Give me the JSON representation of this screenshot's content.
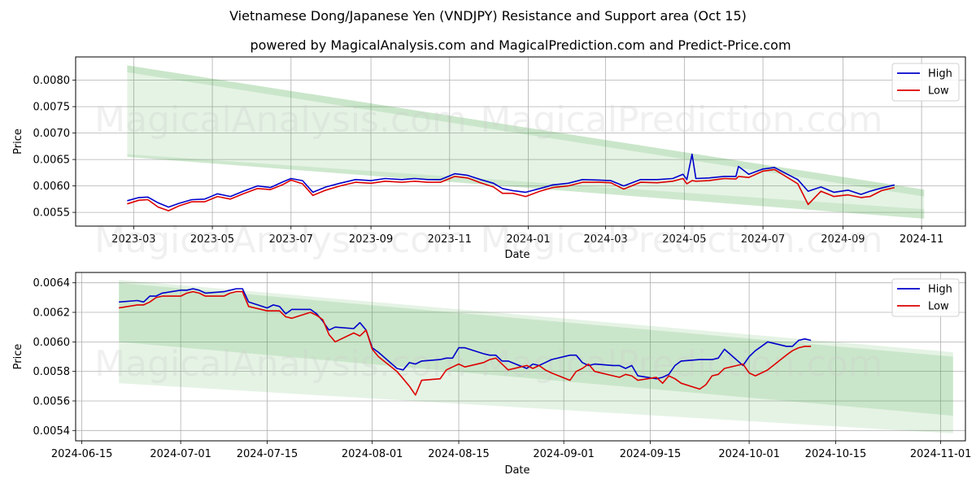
{
  "title": "Vietnamese Dong/Japanese Yen (VNDJPY) Resistance and Support area (Oct 15)",
  "subtitle": "powered by MagicalAnalysis.com and MagicalPrediction.com and Predict-Price.com",
  "watermarks": [
    "MagicalAnalysis.com",
    "MagicalPrediction.com"
  ],
  "colors": {
    "high": "#0000cc",
    "low": "#dd0000",
    "band": "#2ca02c"
  },
  "chart_data": [
    {
      "type": "line",
      "name": "full-history",
      "xlabel": "Date",
      "ylabel": "Price",
      "xlim": [
        "2023-01-15",
        "2024-12-05"
      ],
      "ylim": [
        0.00524,
        0.00844
      ],
      "grid": true,
      "legend": "top-right",
      "legend_entries": [
        "High",
        "Low"
      ],
      "xticks": [
        "2023-03",
        "2023-05",
        "2023-07",
        "2023-09",
        "2023-11",
        "2024-01",
        "2024-03",
        "2024-05",
        "2024-07",
        "2024-09",
        "2024-11"
      ],
      "xtick_dates": [
        "2023-03-01",
        "2023-05-01",
        "2023-07-01",
        "2023-09-01",
        "2023-11-01",
        "2024-01-01",
        "2024-03-01",
        "2024-05-01",
        "2024-07-01",
        "2024-09-01",
        "2024-11-01"
      ],
      "yticks": [
        "0.0055",
        "0.0060",
        "0.0065",
        "0.0070",
        "0.0075",
        "0.0080"
      ],
      "ytick_values": [
        0.0055,
        0.006,
        0.0065,
        0.007,
        0.0075,
        0.008
      ],
      "bands": {
        "start": "2023-02-24",
        "end": "2024-11-03",
        "resistance_outer": [
          0.00828,
          0.00593
        ],
        "resistance_inner": [
          0.00815,
          0.0058
        ],
        "support_inner": [
          0.0066,
          0.00556
        ],
        "support_outer": [
          0.00655,
          0.00538
        ]
      },
      "x": [
        "2023-02-24",
        "2023-03-05",
        "2023-03-12",
        "2023-03-20",
        "2023-03-28",
        "2023-04-05",
        "2023-04-15",
        "2023-04-25",
        "2023-05-05",
        "2023-05-15",
        "2023-05-25",
        "2023-06-05",
        "2023-06-15",
        "2023-06-25",
        "2023-07-01",
        "2023-07-10",
        "2023-07-18",
        "2023-07-28",
        "2023-08-08",
        "2023-08-20",
        "2023-09-01",
        "2023-09-12",
        "2023-09-25",
        "2023-10-05",
        "2023-10-15",
        "2023-10-25",
        "2023-11-05",
        "2023-11-15",
        "2023-11-25",
        "2023-12-05",
        "2023-12-12",
        "2023-12-20",
        "2023-12-30",
        "2024-01-10",
        "2024-01-20",
        "2024-02-01",
        "2024-02-12",
        "2024-02-25",
        "2024-03-05",
        "2024-03-15",
        "2024-03-28",
        "2024-04-10",
        "2024-04-22",
        "2024-04-30",
        "2024-05-03",
        "2024-05-07",
        "2024-05-10",
        "2024-05-20",
        "2024-06-01",
        "2024-06-10",
        "2024-06-12",
        "2024-06-20",
        "2024-07-01",
        "2024-07-10",
        "2024-07-20",
        "2024-07-28",
        "2024-08-05",
        "2024-08-15",
        "2024-08-25",
        "2024-09-05",
        "2024-09-15",
        "2024-09-22",
        "2024-10-01",
        "2024-10-11"
      ],
      "series": [
        {
          "name": "High",
          "values": [
            0.00572,
            0.00578,
            0.00579,
            0.00568,
            0.0056,
            0.00567,
            0.00574,
            0.00575,
            0.00585,
            0.0058,
            0.0059,
            0.006,
            0.00597,
            0.00608,
            0.00614,
            0.0061,
            0.00588,
            0.00598,
            0.00605,
            0.00612,
            0.0061,
            0.00614,
            0.00612,
            0.00614,
            0.00612,
            0.00612,
            0.00623,
            0.0062,
            0.00612,
            0.00605,
            0.00595,
            0.00591,
            0.00588,
            0.00595,
            0.00602,
            0.00605,
            0.00612,
            0.00611,
            0.0061,
            0.006,
            0.00612,
            0.00612,
            0.00614,
            0.00622,
            0.00612,
            0.0066,
            0.00614,
            0.00615,
            0.00618,
            0.00618,
            0.00637,
            0.00622,
            0.00632,
            0.00635,
            0.00622,
            0.00612,
            0.0059,
            0.00598,
            0.00588,
            0.00592,
            0.00584,
            0.0059,
            0.00596,
            0.00602
          ]
        },
        {
          "name": "Low",
          "values": [
            0.00566,
            0.00573,
            0.00574,
            0.0056,
            0.00553,
            0.00562,
            0.0057,
            0.0057,
            0.0058,
            0.00575,
            0.00585,
            0.00595,
            0.00593,
            0.00603,
            0.00611,
            0.00604,
            0.00582,
            0.00592,
            0.006,
            0.00607,
            0.00605,
            0.00609,
            0.00607,
            0.00609,
            0.00607,
            0.00607,
            0.00618,
            0.00615,
            0.00606,
            0.00598,
            0.00586,
            0.00586,
            0.0058,
            0.0059,
            0.00597,
            0.006,
            0.00607,
            0.00607,
            0.00606,
            0.00594,
            0.00607,
            0.00606,
            0.00609,
            0.00614,
            0.00604,
            0.0061,
            0.00609,
            0.0061,
            0.00614,
            0.00613,
            0.00618,
            0.00616,
            0.00628,
            0.00631,
            0.00616,
            0.00604,
            0.00565,
            0.0059,
            0.0058,
            0.00583,
            0.00578,
            0.0058,
            0.00591,
            0.00597
          ]
        }
      ]
    },
    {
      "type": "line",
      "name": "recent",
      "xlabel": "Date",
      "ylabel": "Price",
      "xlim": [
        "2024-06-14",
        "2024-11-05"
      ],
      "ylim": [
        0.00533,
        0.00647
      ],
      "grid": true,
      "legend": "top-right",
      "legend_entries": [
        "High",
        "Low"
      ],
      "xticks": [
        "2024-06-15",
        "2024-07-01",
        "2024-07-15",
        "2024-08-01",
        "2024-08-15",
        "2024-09-01",
        "2024-09-15",
        "2024-10-01",
        "2024-10-15",
        "2024-11-01"
      ],
      "xtick_dates": [
        "2024-06-15",
        "2024-07-01",
        "2024-07-15",
        "2024-08-01",
        "2024-08-15",
        "2024-09-01",
        "2024-09-15",
        "2024-10-01",
        "2024-10-15",
        "2024-11-01"
      ],
      "yticks": [
        "0.0054",
        "0.0056",
        "0.0058",
        "0.0060",
        "0.0062",
        "0.0064"
      ],
      "ytick_values": [
        0.0054,
        0.0056,
        0.0058,
        0.006,
        0.0062,
        0.0064
      ],
      "bands": {
        "start": "2024-06-21",
        "end": "2024-11-03",
        "resistance_outer": [
          0.00642,
          0.00593
        ],
        "resistance_inner": [
          0.0064,
          0.0059
        ],
        "support_inner": [
          0.006,
          0.0055
        ],
        "support_outer": [
          0.00572,
          0.00538
        ]
      },
      "x": [
        "2024-06-21",
        "2024-06-24",
        "2024-06-25",
        "2024-06-26",
        "2024-06-27",
        "2024-06-28",
        "2024-07-01",
        "2024-07-02",
        "2024-07-03",
        "2024-07-04",
        "2024-07-05",
        "2024-07-08",
        "2024-07-09",
        "2024-07-10",
        "2024-07-11",
        "2024-07-12",
        "2024-07-15",
        "2024-07-16",
        "2024-07-17",
        "2024-07-18",
        "2024-07-19",
        "2024-07-22",
        "2024-07-23",
        "2024-07-24",
        "2024-07-25",
        "2024-07-26",
        "2024-07-29",
        "2024-07-30",
        "2024-07-31",
        "2024-08-01",
        "2024-08-02",
        "2024-08-05",
        "2024-08-06",
        "2024-08-07",
        "2024-08-08",
        "2024-08-09",
        "2024-08-12",
        "2024-08-13",
        "2024-08-14",
        "2024-08-15",
        "2024-08-16",
        "2024-08-19",
        "2024-08-20",
        "2024-08-21",
        "2024-08-22",
        "2024-08-23",
        "2024-08-26",
        "2024-08-27",
        "2024-08-28",
        "2024-08-29",
        "2024-08-30",
        "2024-09-02",
        "2024-09-03",
        "2024-09-04",
        "2024-09-05",
        "2024-09-06",
        "2024-09-09",
        "2024-09-10",
        "2024-09-11",
        "2024-09-12",
        "2024-09-13",
        "2024-09-16",
        "2024-09-17",
        "2024-09-18",
        "2024-09-19",
        "2024-09-20",
        "2024-09-23",
        "2024-09-24",
        "2024-09-25",
        "2024-09-26",
        "2024-09-27",
        "2024-09-30",
        "2024-10-01",
        "2024-10-02",
        "2024-10-03",
        "2024-10-04",
        "2024-10-07",
        "2024-10-08",
        "2024-10-09",
        "2024-10-10",
        "2024-10-11"
      ],
      "series": [
        {
          "name": "High",
          "values": [
            0.00627,
            0.00628,
            0.00627,
            0.00631,
            0.00631,
            0.00633,
            0.00635,
            0.00635,
            0.00636,
            0.00635,
            0.00633,
            0.00634,
            0.00635,
            0.00636,
            0.00636,
            0.00627,
            0.00623,
            0.00625,
            0.00624,
            0.00619,
            0.00622,
            0.00622,
            0.00619,
            0.00614,
            0.00608,
            0.0061,
            0.00609,
            0.00613,
            0.00608,
            0.00596,
            0.00593,
            0.00582,
            0.00581,
            0.00586,
            0.00585,
            0.00587,
            0.00588,
            0.00589,
            0.00589,
            0.00596,
            0.00596,
            0.00592,
            0.00591,
            0.00591,
            0.00587,
            0.00587,
            0.00582,
            0.00585,
            0.00584,
            0.00586,
            0.00588,
            0.00591,
            0.00591,
            0.00586,
            0.00584,
            0.00585,
            0.00584,
            0.00584,
            0.00582,
            0.00584,
            0.00577,
            0.00575,
            0.00576,
            0.00578,
            0.00584,
            0.00587,
            0.00588,
            0.00588,
            0.00588,
            0.00589,
            0.00595,
            0.00584,
            0.0059,
            0.00594,
            0.00597,
            0.006,
            0.00597,
            0.00597,
            0.00601,
            0.00602,
            0.00601
          ]
        },
        {
          "name": "Low",
          "values": [
            0.00623,
            0.00625,
            0.00625,
            0.00627,
            0.0063,
            0.00631,
            0.00631,
            0.00633,
            0.00634,
            0.00633,
            0.00631,
            0.00631,
            0.00633,
            0.00634,
            0.00634,
            0.00624,
            0.00621,
            0.00621,
            0.00621,
            0.00617,
            0.00616,
            0.0062,
            0.00618,
            0.00615,
            0.00605,
            0.006,
            0.00606,
            0.00604,
            0.00608,
            0.00595,
            0.0059,
            0.0058,
            0.00575,
            0.0057,
            0.00564,
            0.00574,
            0.00575,
            0.00581,
            0.00583,
            0.00585,
            0.00583,
            0.00586,
            0.00588,
            0.00589,
            0.00585,
            0.00581,
            0.00584,
            0.00582,
            0.00584,
            0.00581,
            0.00579,
            0.00574,
            0.0058,
            0.00582,
            0.00585,
            0.0058,
            0.00577,
            0.00576,
            0.00578,
            0.00577,
            0.00574,
            0.00576,
            0.00572,
            0.00577,
            0.00575,
            0.00572,
            0.00568,
            0.00571,
            0.00577,
            0.00578,
            0.00582,
            0.00585,
            0.00579,
            0.00577,
            0.00579,
            0.00581,
            0.00591,
            0.00594,
            0.00596,
            0.00597,
            0.00597
          ]
        }
      ]
    }
  ]
}
